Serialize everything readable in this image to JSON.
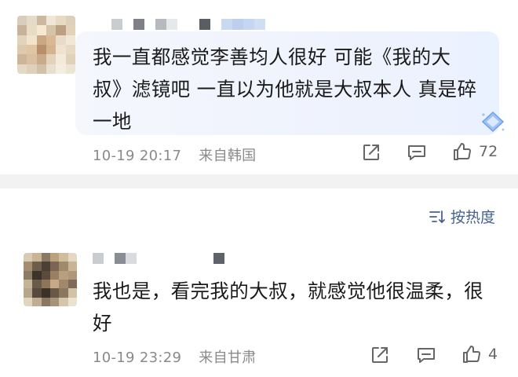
{
  "comments": [
    {
      "text_lines": [
        "我一直都感觉李善均人很好 可能《我的大",
        "叔》滤镜吧 一直以为他就是大叔本人 真是碎",
        "一地"
      ],
      "date": "10-19 20:17",
      "location": "来自韩国",
      "likes": "72",
      "icons": [
        "share-icon",
        "comment-icon",
        "like-icon"
      ],
      "avatar_colors": [
        "#d9cdbb",
        "#e6dac8",
        "#cbb89e",
        "#f0e6d6",
        "#e8d9c1",
        "#ddd0bc",
        "#c8b39a",
        "#e9dcc6",
        "#f5e9d3",
        "#d7c4a8",
        "#bba182",
        "#e3d2ba",
        "#e2d3bd",
        "#f2e4cc",
        "#caa884",
        "#d9b995",
        "#e8dcc8",
        "#f1e7d7",
        "#dcc9ae",
        "#e1c6a3",
        "#b88f6a",
        "#d4b48e",
        "#efe3d0",
        "#e7dac5",
        "#cdb597",
        "#d8c0a0",
        "#c9ab8a",
        "#e4d3bb",
        "#f3ead9",
        "#e0d1bb",
        "#e5d8c4",
        "#ded0bb",
        "#d3c1a7",
        "#e9dfcf",
        "#f4ede0",
        "#eee4d3"
      ],
      "name_mosaic": [
        "#c9ccd1",
        "#ffffff",
        "#7d8087",
        "#ffffff",
        "#b6b9be",
        "#e6e8ea",
        "#ffffff",
        "#ffffff",
        "#5a5d63",
        "#ffffff",
        "#c9d9f2",
        "#bcd0ee",
        "#c4d6f1",
        "#d0def3"
      ]
    },
    {
      "text_lines": [
        "我也是，看完我的大叔，就感觉他很温柔，很",
        "好"
      ],
      "date": "10-19 23:29",
      "location": "来自甘肃",
      "likes": "4",
      "icons": [
        "share-icon",
        "comment-icon",
        "like-icon"
      ],
      "avatar_colors": [
        "#d8cbb3",
        "#c9b594",
        "#8b7a63",
        "#b9a27d",
        "#cfbd9e",
        "#e4d8c2",
        "#a48e6f",
        "#6e5d4a",
        "#4c3f33",
        "#7a6652",
        "#a08a6b",
        "#c7b595",
        "#8d7b64",
        "#3e332a",
        "#5b4b3c",
        "#9a7f64",
        "#b89f80",
        "#ae9677",
        "#c4b396",
        "#6b5a48",
        "#8f7558",
        "#c8a886",
        "#a3876a",
        "#7e6a56",
        "#b7a68b",
        "#574a3d",
        "#3b3129",
        "#6a5847",
        "#8b7660",
        "#d2c2a6",
        "#e1d5c0",
        "#bfae91",
        "#8a7862",
        "#a69378",
        "#d4c6ad",
        "#ebe2d1"
      ],
      "name_mosaic": [
        "#c9ccd1",
        "#ffffff",
        "#8a8d93",
        "#d9dbde",
        "#ffffff",
        "#ffffff",
        "#ffffff",
        "#ffffff",
        "#ffffff",
        "#ffffff",
        "#ffffff",
        "#5f6268"
      ]
    }
  ],
  "sort": {
    "label": "按热度",
    "icon": "sort-icon"
  },
  "colors": {
    "accent": "#45628f",
    "meta": "#8a8a8a",
    "divider": "#f2f2f2"
  }
}
